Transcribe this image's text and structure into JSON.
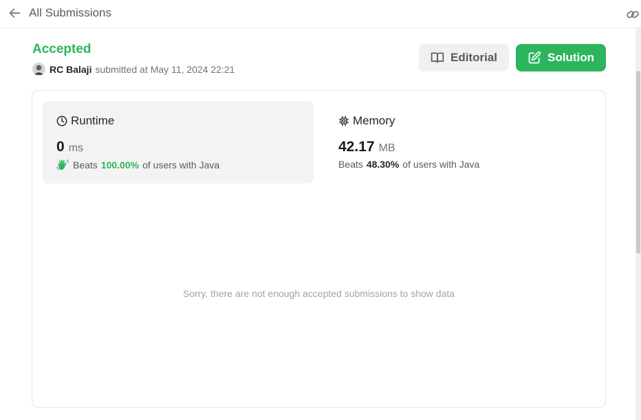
{
  "header": {
    "back_label": "All Submissions",
    "back_icon": "arrow-left-icon",
    "link_icon": "link-icon"
  },
  "submission": {
    "status": "Accepted",
    "user": "RC Balaji",
    "submitted_text": "submitted at",
    "timestamp": "May 11, 2024 22:21"
  },
  "actions": {
    "editorial_label": "Editorial",
    "solution_label": "Solution"
  },
  "runtime": {
    "title": "Runtime",
    "value": "0",
    "unit": "ms",
    "beats_label": "Beats",
    "percent": "100.00%",
    "suffix": "of users with Java"
  },
  "memory": {
    "title": "Memory",
    "value": "42.17",
    "unit": "MB",
    "beats_label": "Beats",
    "percent": "48.30%",
    "suffix": "of users with Java"
  },
  "empty_message": "Sorry, there are not enough accepted submissions to show data",
  "colors": {
    "accent_green": "#2db55d",
    "panel_bg": "#f3f3f3",
    "border": "#e5e5e5"
  }
}
